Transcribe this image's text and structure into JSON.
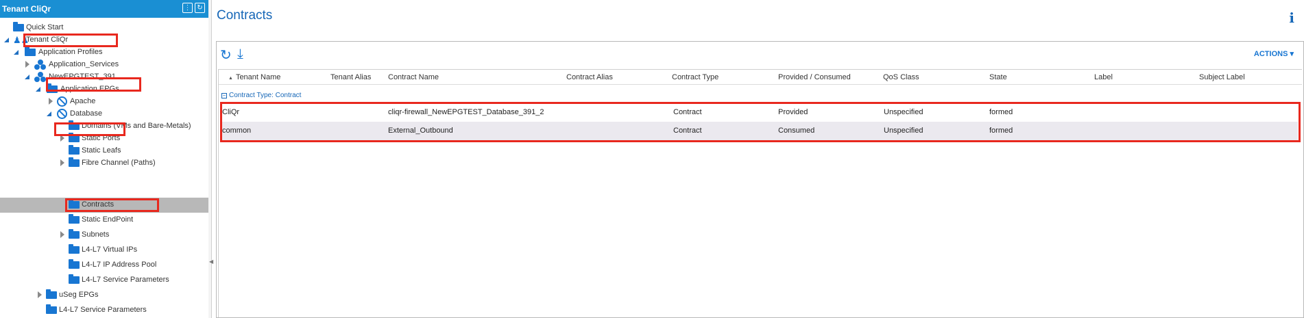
{
  "nav": {
    "title": "Tenant CliQr",
    "items": [
      {
        "label": "Quick Start"
      },
      {
        "label": "Tenant CliQr"
      },
      {
        "label": "Application Profiles"
      },
      {
        "label": "Application_Services"
      },
      {
        "label": "NewEPGTEST_391"
      },
      {
        "label": "Application EPGs"
      },
      {
        "label": "Apache"
      },
      {
        "label": "Database"
      },
      {
        "label": "Domains (VMs and Bare-Metals)"
      },
      {
        "label": "Static Ports"
      },
      {
        "label": "Static Leafs"
      },
      {
        "label": "Fibre Channel (Paths)"
      },
      {
        "label": "Contracts"
      },
      {
        "label": "Static EndPoint"
      },
      {
        "label": "Subnets"
      },
      {
        "label": "L4-L7 Virtual IPs"
      },
      {
        "label": "L4-L7 IP Address Pool"
      },
      {
        "label": "L4-L7 Service Parameters"
      },
      {
        "label": "uSeg EPGs"
      },
      {
        "label": "L4-L7 Service Parameters"
      }
    ]
  },
  "main": {
    "title": "Contracts",
    "actions_label": "ACTIONS",
    "group_label": "Contract Type: Contract",
    "columns": [
      "Tenant Name",
      "Tenant Alias",
      "Contract Name",
      "Contract Alias",
      "Contract Type",
      "Provided / Consumed",
      "QoS Class",
      "State",
      "Label",
      "Subject Label"
    ],
    "rows": [
      {
        "tenant": "CliQr",
        "alias": "",
        "contract": "cliqr-firewall_NewEPGTEST_Database_391_2",
        "contract_alias": "",
        "type": "Contract",
        "provided": "Provided",
        "qos": "Unspecified",
        "state": "formed",
        "label": "",
        "subject_label": ""
      },
      {
        "tenant": "common",
        "alias": "",
        "contract": "External_Outbound",
        "contract_alias": "",
        "type": "Contract",
        "provided": "Consumed",
        "qos": "Unspecified",
        "state": "formed",
        "label": "",
        "subject_label": ""
      }
    ]
  },
  "colors": {
    "accent": "#1a8fd3",
    "highlight": "#e8281e",
    "selected": "#b8b8b8"
  }
}
